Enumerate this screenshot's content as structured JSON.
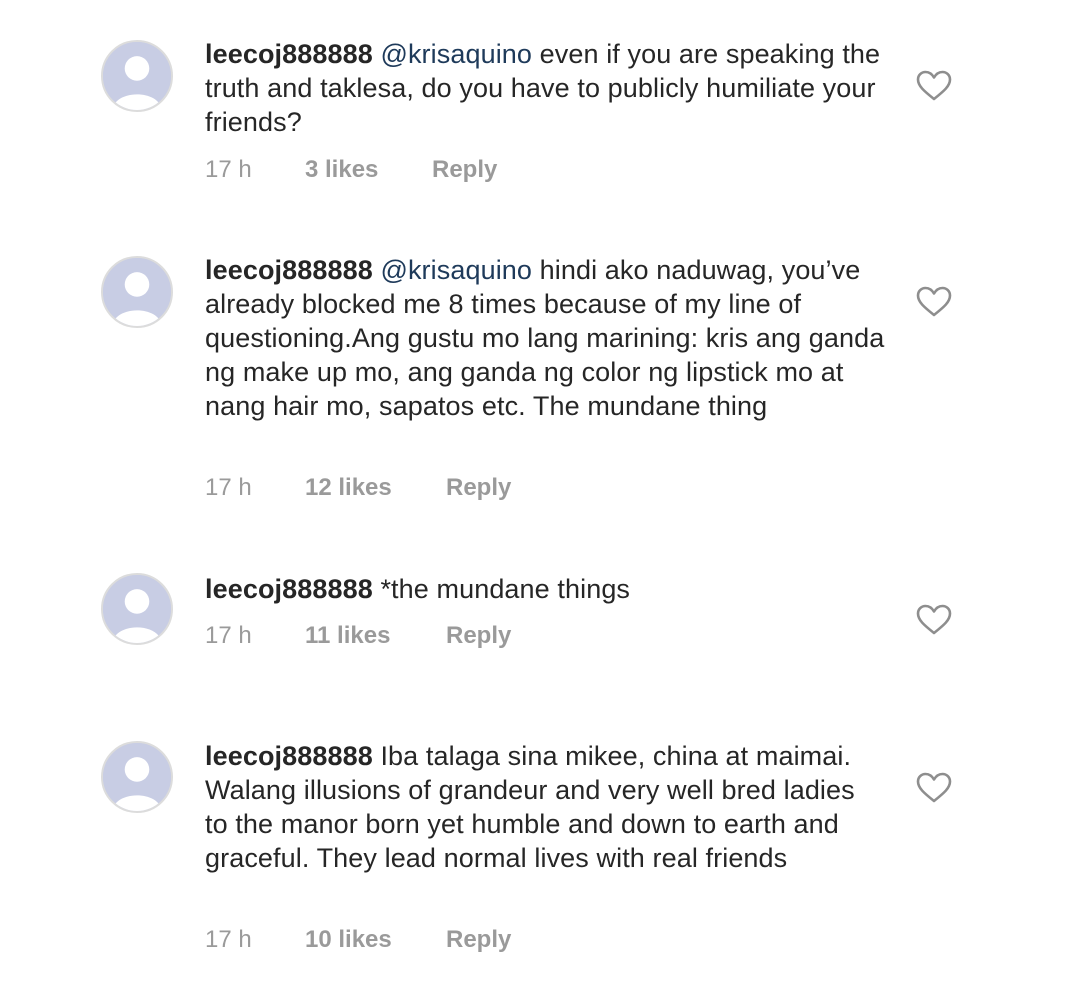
{
  "comments": [
    {
      "username": "leecoj888888",
      "mention": "@krisaquino",
      "text": "even if you are speaking the truth and taklesa, do you have to publicly humiliate your friends?",
      "time": "17 h",
      "likes": "3 likes",
      "reply": "Reply"
    },
    {
      "username": "leecoj888888",
      "mention": "@krisaquino",
      "text": "hindi ako naduwag, you’ve already blocked me 8 times because of my line of questioning.Ang gustu mo lang marining: kris ang ganda ng make up mo, ang ganda ng color ng lipstick mo at nang hair mo, sapatos etc. The mundane thing",
      "time": "17 h",
      "likes": "12 likes",
      "reply": "Reply"
    },
    {
      "username": "leecoj888888",
      "mention": "",
      "text": "*the mundane things",
      "time": "17 h",
      "likes": "11 likes",
      "reply": "Reply"
    },
    {
      "username": "leecoj888888",
      "mention": "",
      "text": "Iba talaga sina mikee, china at maimai. Walang illusions of grandeur and very well bred ladies to the manor born yet humble and down to earth and graceful. They lead normal lives with real friends",
      "time": "17 h",
      "likes": "10 likes",
      "reply": "Reply"
    }
  ],
  "icons": {
    "avatar": "default-avatar-icon",
    "like": "heart-outline-icon"
  },
  "colors": {
    "text": "#262626",
    "mention": "#1e3a5a",
    "meta": "#9a9a9a",
    "avatar_bg": "#c8cde4",
    "heart": "#8e8e8e"
  }
}
